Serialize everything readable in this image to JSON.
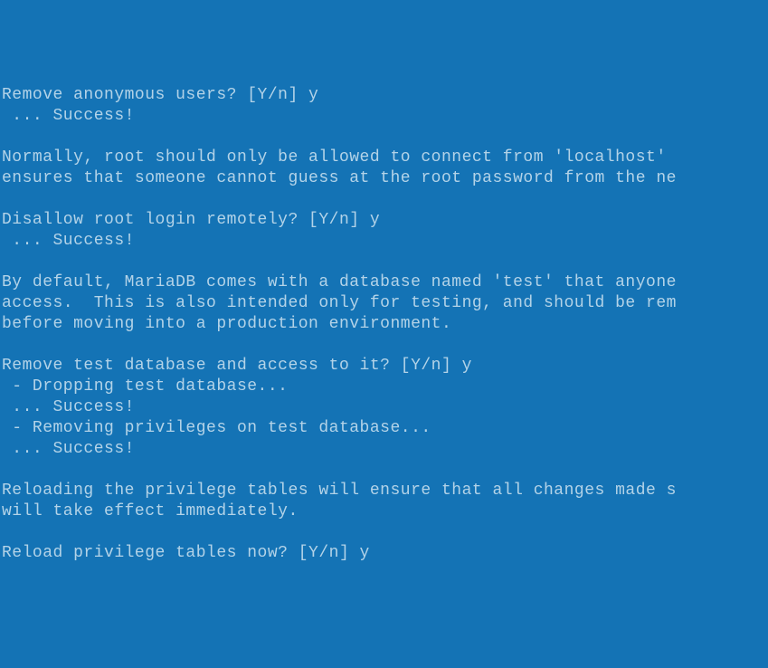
{
  "terminal": {
    "lines": [
      "Remove anonymous users? [Y/n] y",
      " ... Success!",
      "",
      "Normally, root should only be allowed to connect from 'localhost'",
      "ensures that someone cannot guess at the root password from the ne",
      "",
      "Disallow root login remotely? [Y/n] y",
      " ... Success!",
      "",
      "By default, MariaDB comes with a database named 'test' that anyone",
      "access.  This is also intended only for testing, and should be rem",
      "before moving into a production environment.",
      "",
      "Remove test database and access to it? [Y/n] y",
      " - Dropping test database...",
      " ... Success!",
      " - Removing privileges on test database...",
      " ... Success!",
      "",
      "Reloading the privilege tables will ensure that all changes made s",
      "will take effect immediately.",
      "",
      "Reload privilege tables now? [Y/n] y"
    ]
  }
}
